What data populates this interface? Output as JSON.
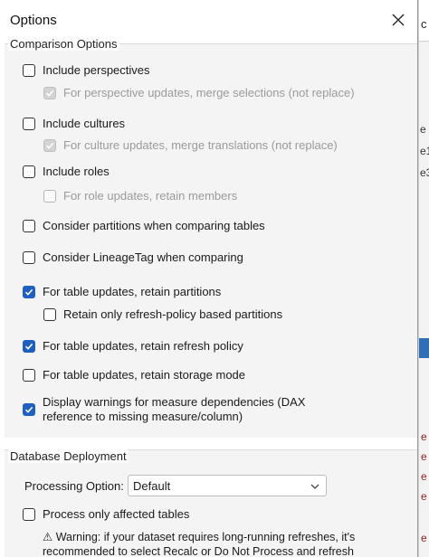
{
  "dialog": {
    "title": "Options"
  },
  "background_app": {
    "fragments": [
      "c",
      "e",
      "e1",
      "e3"
    ]
  },
  "comparison": {
    "legend": "Comparison Options",
    "include_perspectives": {
      "label": "Include perspectives",
      "checked": false
    },
    "perspective_merge": {
      "label": "For perspective updates, merge selections (not replace)",
      "checked": true,
      "disabled": true
    },
    "include_cultures": {
      "label": "Include cultures",
      "checked": false
    },
    "culture_merge": {
      "label": "For culture updates, merge translations (not replace)",
      "checked": true,
      "disabled": true
    },
    "include_roles": {
      "label": "Include roles",
      "checked": false
    },
    "role_retain": {
      "label": "For role updates, retain members",
      "checked": false,
      "disabled": true
    },
    "consider_partitions": {
      "label": "Consider partitions when comparing tables",
      "checked": false
    },
    "consider_lineage": {
      "label": "Consider LineageTag when comparing",
      "checked": false
    },
    "retain_partitions": {
      "label": "For table updates, retain partitions",
      "checked": true
    },
    "retain_refresh_only": {
      "label": "Retain only refresh-policy based partitions",
      "checked": false
    },
    "retain_refresh_policy": {
      "label": "For table updates, retain refresh policy",
      "checked": true
    },
    "retain_storage_mode": {
      "label": "For table updates, retain storage mode",
      "checked": false
    },
    "display_warnings": {
      "label_line1": "Display warnings for measure dependencies (DAX",
      "label_line2": "reference to missing measure/column)",
      "checked": true
    }
  },
  "deployment": {
    "legend": "Database Deployment",
    "processing_label": "Processing Option:",
    "processing_value": "Default",
    "process_affected": {
      "label": "Process only affected tables",
      "checked": false
    },
    "warning_line1": "Warning: if your dataset requires long-running refreshes, it's",
    "warning_line2": "recommended to select Recalc or Do Not Process and refresh"
  },
  "colors": {
    "accent": "#1f5fbf",
    "disabled_text": "#9a9a9a"
  }
}
